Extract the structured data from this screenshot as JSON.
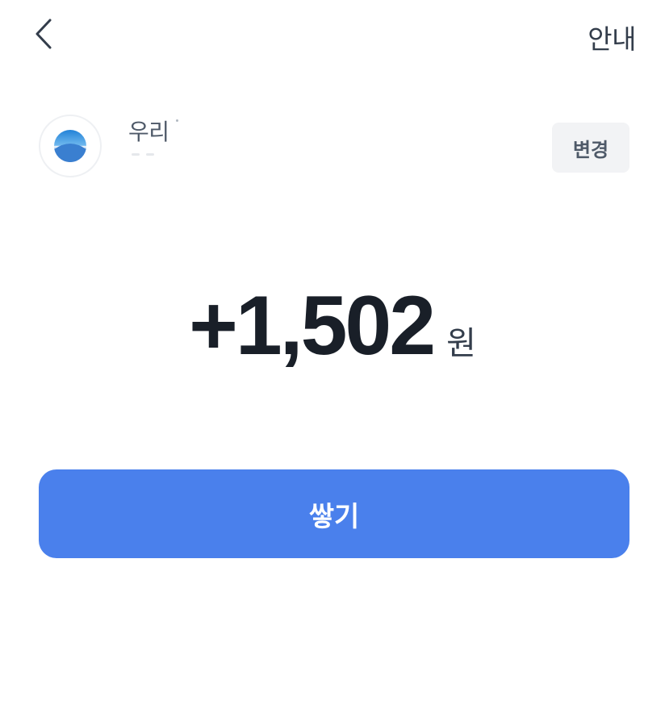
{
  "header": {
    "back_icon": "chevron-left-icon",
    "info_label": "안내"
  },
  "account": {
    "bank_name": "우리",
    "bank_logo_icon": "woori-bank-logo-icon",
    "change_label": "변경"
  },
  "amount": {
    "value": "+1,502",
    "unit": "원"
  },
  "action": {
    "save_label": "쌓기"
  },
  "colors": {
    "primary_button": "#4a80ec",
    "change_button_bg": "#f2f3f5",
    "amount_text": "#191f28",
    "logo_blue": "#3a7fd0"
  }
}
